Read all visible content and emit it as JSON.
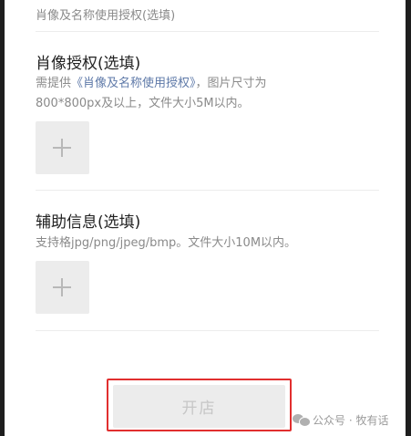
{
  "top_field": {
    "label": "肖像及名称使用授权(选填)"
  },
  "portrait_section": {
    "title": "肖像授权(选填)",
    "desc_prefix": "需提供",
    "desc_link": "《肖像及名称使用授权》",
    "desc_suffix": "，图片尺寸为",
    "desc_line2": "800*800px及以上，文件大小5M以内。"
  },
  "aux_section": {
    "title": "辅助信息(选填)",
    "desc": "支持格jpg/png/jpeg/bmp。文件大小10M以内。"
  },
  "footer": {
    "open_button_label": "开店",
    "watermark": "公众号 · 牧有话"
  },
  "colors": {
    "link": "#5e79a8",
    "highlight_border": "#e12f2f",
    "upload_box": "#ececec"
  }
}
